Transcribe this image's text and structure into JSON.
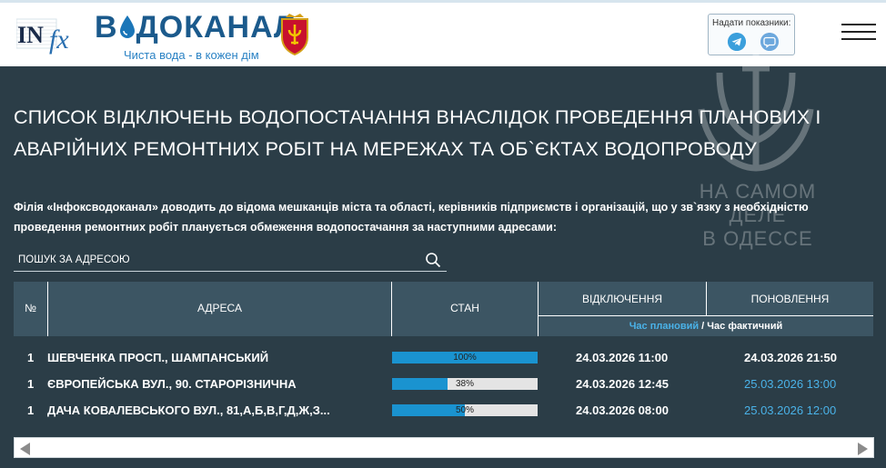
{
  "header": {
    "logo_text": "ВОДОКАНАЛ",
    "slogan": "Чиста вода - в кожен дім",
    "meters_label": "Надати показники:",
    "menu_icon": "hamburger-icon"
  },
  "title": "Список відключень водопостачання внаслідок проведення планових і аварійних ремонтних робіт на мережах та об`єктах водопроводу",
  "intro": "Філія «Інфоксводоканал» доводить до відома мешканців міста та області, керівників підприємств і організацій, що у зв`язку з необхідністю проведення ремонтних робіт планується обмеження водопостачання за наступними адресами:",
  "watermark": {
    "line1": "НА САМОМ ДЕЛЕ",
    "line2": "В ОДЕССЕ"
  },
  "search": {
    "placeholder": "ПОШУК ЗА АДРЕСОЮ"
  },
  "table": {
    "headers": {
      "num": "№",
      "address": "АДРЕСА",
      "status": "СТАН",
      "off": "ВІДКЛЮЧЕННЯ",
      "update": "ПОНОВЛЕННЯ"
    },
    "legend": {
      "planned": "Час плановий",
      "sep": " / ",
      "actual": "Час фактичний"
    },
    "rows": [
      {
        "num": "1",
        "address": "ШЕВЧЕНКА ПРОСП., ШАМПАНСЬКИЙ",
        "progress": 100,
        "progress_label": "100%",
        "off": "24.03.2026 11:00",
        "update": "24.03.2026 21:50",
        "update_planned": false
      },
      {
        "num": "1",
        "address": "ЄВРОПЕЙСЬКА ВУЛ., 90. СТАРОРІЗНИЧНА",
        "progress": 38,
        "progress_label": "38%",
        "off": "24.03.2026 12:45",
        "update": "25.03.2026 13:00",
        "update_planned": true
      },
      {
        "num": "1",
        "address": "ДАЧА КОВАЛЕВСЬКОГО ВУЛ., 81,А,Б,В,Г,Д,Ж,З...",
        "progress": 50,
        "progress_label": "50%",
        "off": "24.03.2026 08:00",
        "update": "25.03.2026 12:00",
        "update_planned": true
      }
    ]
  },
  "colors": {
    "page_bg": "#2b3d47",
    "table_header": "#3c5563",
    "progress": "#1a93d0",
    "planned_time": "#4ab2e8",
    "logo": "#1b5a8c"
  }
}
